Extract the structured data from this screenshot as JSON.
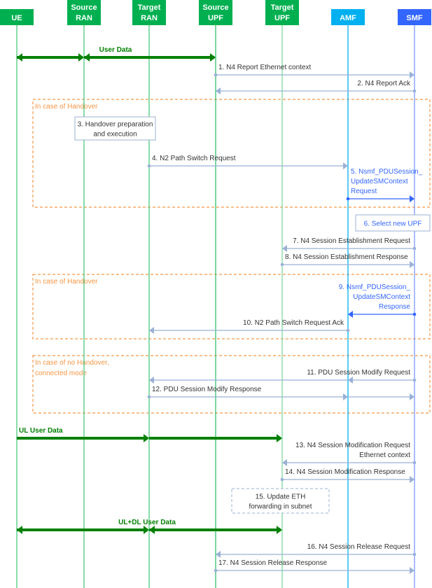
{
  "participants": [
    {
      "id": "ue",
      "lines": [
        "UE"
      ],
      "color": "#00b050"
    },
    {
      "id": "source-ran",
      "lines": [
        "Source",
        "RAN"
      ],
      "color": "#00b050"
    },
    {
      "id": "target-ran",
      "lines": [
        "Target",
        "RAN"
      ],
      "color": "#00b050"
    },
    {
      "id": "source-upf",
      "lines": [
        "Source",
        "UPF"
      ],
      "color": "#00b050"
    },
    {
      "id": "target-upf",
      "lines": [
        "Target",
        "UPF"
      ],
      "color": "#00b050"
    },
    {
      "id": "amf",
      "lines": [
        "AMF"
      ],
      "color": "#00b0f0"
    },
    {
      "id": "smf",
      "lines": [
        "SMF"
      ],
      "color": "#3366ff"
    }
  ],
  "colors": {
    "message": "#9bb1d6",
    "text": "#333333",
    "highlight": "#3366ff",
    "user_data": "#008000",
    "condition": "#f79646"
  },
  "conditions": [
    {
      "lines": [
        "In case of Handover"
      ]
    },
    {
      "lines": [
        "In case of Handover"
      ]
    },
    {
      "lines": [
        "In case of no Handover,",
        "connected mode"
      ]
    }
  ],
  "notes": [
    {
      "lines": [
        "3. Handover preparation",
        "and execution"
      ],
      "style": "normal"
    },
    {
      "lines": [
        "6. Select new UPF"
      ],
      "style": "highlight"
    },
    {
      "lines": [
        "15. Update ETH",
        "forwarding in subnet"
      ],
      "style": "dashed"
    }
  ],
  "messages": [
    {
      "lines": [
        "User Data"
      ],
      "path": [
        "ue",
        "source-ran",
        "source-upf"
      ],
      "style": "user-data",
      "bidirectional": true
    },
    {
      "lines": [
        "1. N4 Report Ethernet context"
      ],
      "path": [
        "source-upf",
        "smf"
      ],
      "style": "normal"
    },
    {
      "lines": [
        "2. N4 Report Ack"
      ],
      "path": [
        "smf",
        "source-upf"
      ],
      "style": "normal"
    },
    {
      "lines": [
        "4. N2 Path Switch Request"
      ],
      "path": [
        "target-ran",
        "amf"
      ],
      "style": "normal"
    },
    {
      "lines": [
        "5. Nsmf_PDUSession_",
        "UpdateSMContext",
        "Request"
      ],
      "path": [
        "amf",
        "smf"
      ],
      "style": "highlight"
    },
    {
      "lines": [
        "7. N4 Session Establishment Request"
      ],
      "path": [
        "smf",
        "target-upf"
      ],
      "style": "normal"
    },
    {
      "lines": [
        "8. N4 Session Establishment Response"
      ],
      "path": [
        "target-upf",
        "smf"
      ],
      "style": "normal"
    },
    {
      "lines": [
        "9. Nsmf_PDUSession_",
        "UpdateSMContext",
        "Response"
      ],
      "path": [
        "smf",
        "amf"
      ],
      "style": "highlight"
    },
    {
      "lines": [
        "10. N2 Path Switch Request Ack"
      ],
      "path": [
        "amf",
        "target-ran"
      ],
      "style": "normal"
    },
    {
      "lines": [
        "11. PDU Session Modify Request"
      ],
      "path": [
        "smf",
        "amf",
        "target-ran"
      ],
      "style": "normal"
    },
    {
      "lines": [
        "12. PDU Session Modify Response"
      ],
      "path": [
        "target-ran",
        "amf",
        "smf"
      ],
      "style": "normal"
    },
    {
      "lines": [
        "UL User Data"
      ],
      "path": [
        "ue",
        "target-ran",
        "target-upf"
      ],
      "style": "user-data",
      "bidirectional": false
    },
    {
      "lines": [
        "13. N4 Session Modification Request",
        "Ethernet context"
      ],
      "path": [
        "smf",
        "target-upf"
      ],
      "style": "normal"
    },
    {
      "lines": [
        "14. N4 Session Modification Response"
      ],
      "path": [
        "target-upf",
        "smf"
      ],
      "style": "normal"
    },
    {
      "lines": [
        "UL+DL User Data"
      ],
      "path": [
        "ue",
        "target-ran",
        "target-upf"
      ],
      "style": "user-data",
      "bidirectional": true
    },
    {
      "lines": [
        "16. N4 Session Release Request"
      ],
      "path": [
        "smf",
        "source-upf"
      ],
      "style": "normal"
    },
    {
      "lines": [
        "17. N4 Session Release Response"
      ],
      "path": [
        "source-upf",
        "smf"
      ],
      "style": "normal"
    }
  ]
}
